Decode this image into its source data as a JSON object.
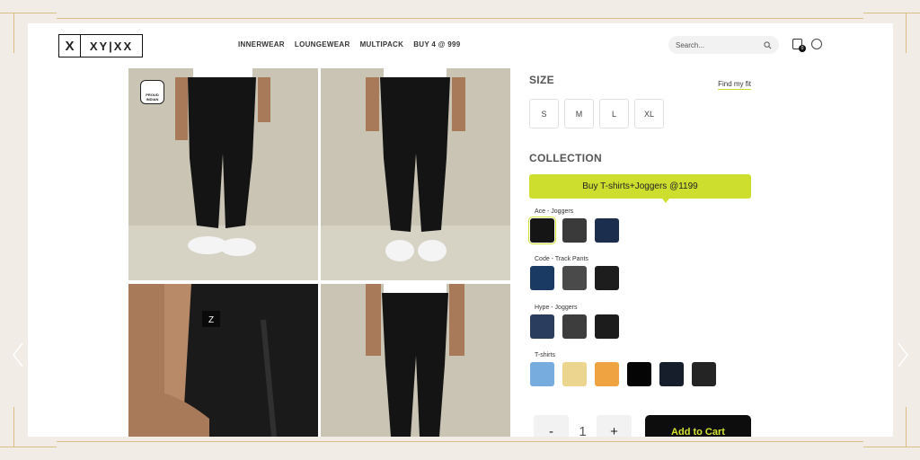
{
  "header": {
    "logo_mark": "X",
    "logo_text": "XY|XX",
    "nav": [
      "INNERWEAR",
      "LOUNGEWEAR",
      "MULTIPACK",
      "BUY 4 @ 999"
    ],
    "search_placeholder": "Search...",
    "cart_count": "0"
  },
  "gallery": {
    "badge_text": "PROUD INDIAN"
  },
  "product": {
    "size_title": "SIZE",
    "find_fit": "Find my fit",
    "sizes": [
      "S",
      "M",
      "L",
      "XL"
    ],
    "collection_title": "COLLECTION",
    "collection_button": "Buy T-shirts+Joggers @1199",
    "groups": [
      {
        "label": "Ace - Joggers",
        "colors": [
          "#151515",
          "#3a3a3a",
          "#1c2e4e"
        ]
      },
      {
        "label": "Code - Track Pants",
        "colors": [
          "#1b3a63",
          "#4a4a4a",
          "#1d1d1d"
        ]
      },
      {
        "label": "Hype - Joggers",
        "colors": [
          "#2a3d5e",
          "#3d3d3d",
          "#1c1c1c"
        ]
      },
      {
        "label": "T-shirts",
        "colors": [
          "#77acde",
          "#ecd58e",
          "#f0a441",
          "#050505",
          "#161d2b",
          "#242424"
        ]
      }
    ],
    "qty_minus": "-",
    "qty_value": "1",
    "qty_plus": "+",
    "add_to_cart": "Add to Cart"
  },
  "colors": {
    "accent": "#cdde2f",
    "background": "#f1ede6",
    "decor": "#d9bf86"
  }
}
